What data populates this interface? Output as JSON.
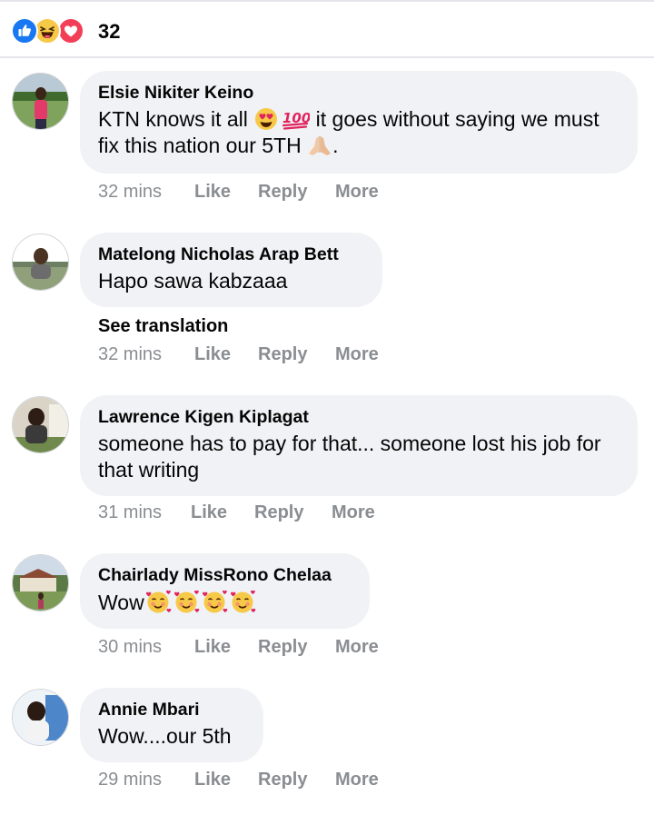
{
  "reactions": {
    "icons": [
      "like-icon",
      "haha-icon",
      "love-icon"
    ],
    "count": "32",
    "colors": {
      "like": "#1877f2",
      "haha": "#f7c948",
      "love": "#f33e58"
    }
  },
  "actions": {
    "like": "Like",
    "reply": "Reply",
    "more": "More"
  },
  "comments": [
    {
      "author": "Elsie Nikiter Keino",
      "text_part1": "KTN knows it all ",
      "text_part2": " it goes without saying we must fix this nation our 5TH ",
      "text_part3": ".",
      "emojis": [
        "heart-eyes-emoji",
        "hundred-points-emoji",
        "folded-hands-emoji"
      ],
      "time": "32 mins"
    },
    {
      "author": "Matelong Nicholas Arap Bett",
      "text": "Hapo sawa kabzaaa",
      "see_translation": "See translation",
      "time": "32 mins"
    },
    {
      "author": "Lawrence Kigen Kiplagat",
      "text": "someone has to pay for that... someone lost his job for that writing",
      "time": "31 mins"
    },
    {
      "author": "Chairlady MissRono Chelaa",
      "text": "Wow",
      "emojis": [
        "smiling-face-with-hearts-emoji",
        "smiling-face-with-hearts-emoji",
        "smiling-face-with-hearts-emoji",
        "smiling-face-with-hearts-emoji"
      ],
      "time": "30 mins"
    },
    {
      "author": "Annie Mbari",
      "text": "Wow....our 5th",
      "time": "29 mins"
    }
  ]
}
